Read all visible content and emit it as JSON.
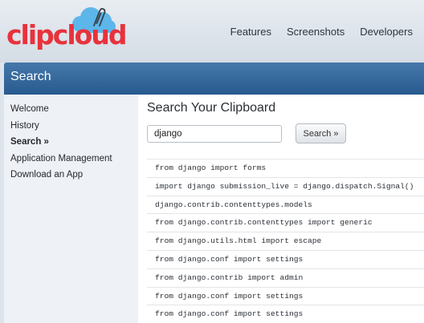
{
  "header": {
    "logo_text": "clipcloud",
    "nav": [
      "Features",
      "Screenshots",
      "Developers"
    ]
  },
  "title_bar": {
    "title": "Search"
  },
  "sidebar": {
    "items": [
      {
        "label": "Welcome"
      },
      {
        "label": "History"
      },
      {
        "label": "Search »"
      },
      {
        "label": "Application Management"
      },
      {
        "label": "Download an App"
      }
    ],
    "active_index": 2
  },
  "main": {
    "heading": "Search Your Clipboard",
    "search": {
      "value": "django",
      "button_label": "Search »"
    },
    "results": [
      "from django import forms",
      "import django submission_live = django.dispatch.Signal()",
      "django.contrib.contenttypes.models",
      "from django.contrib.contenttypes import generic",
      "from django.utils.html import escape",
      "from django.conf import settings",
      "from django.contrib import admin",
      "from django.conf import settings",
      "from django.conf import settings"
    ]
  },
  "colors": {
    "logo_red": "#e8323c",
    "cloud_blue": "#5cb6ea",
    "title_bar_blue": "#2f6398",
    "page_background": "#dde4ec"
  },
  "icons": [
    "cloud-icon",
    "paperclip-icon"
  ]
}
